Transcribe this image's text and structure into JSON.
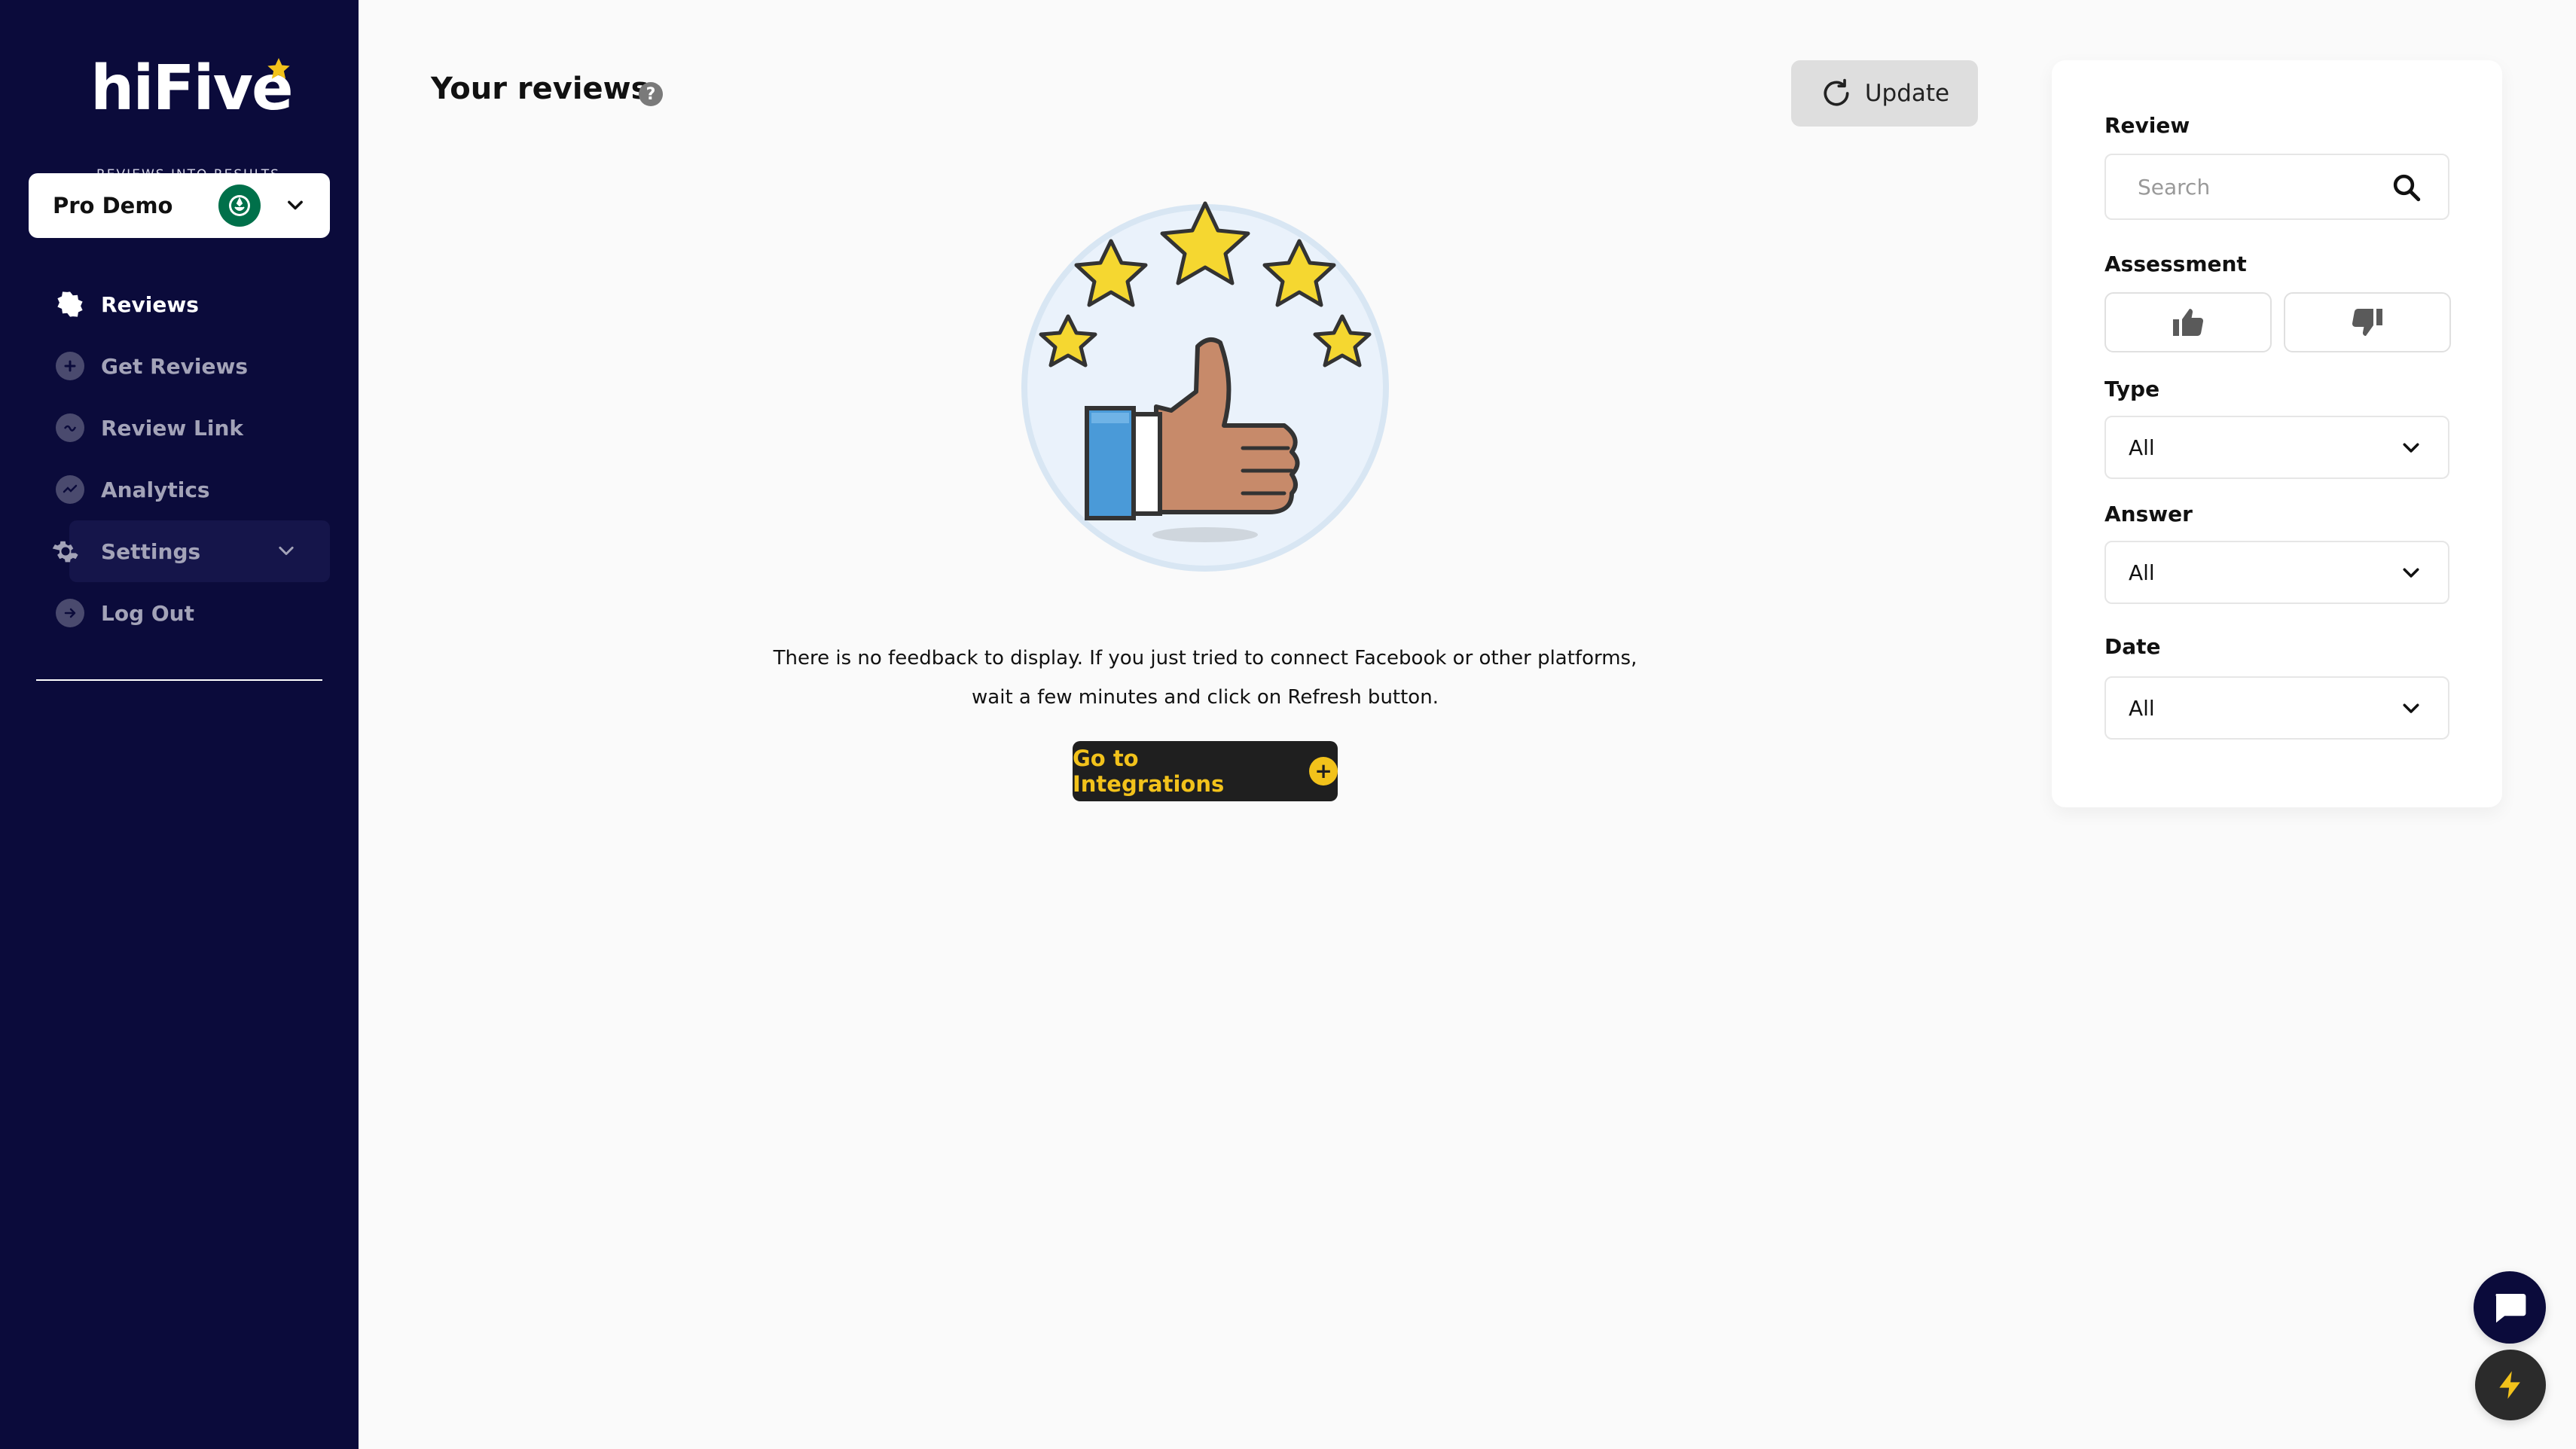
{
  "brand": {
    "name": "hiFive",
    "tagline": "REVIEWS INTO RESULTS."
  },
  "account": {
    "name": "Pro Demo",
    "avatar": "starbucks-logo"
  },
  "nav": {
    "items": [
      {
        "label": "Reviews",
        "icon": "reviews-icon",
        "active": true
      },
      {
        "label": "Get Reviews",
        "icon": "plus-icon",
        "active": false
      },
      {
        "label": "Review Link",
        "icon": "link-icon",
        "active": false
      },
      {
        "label": "Analytics",
        "icon": "analytics-icon",
        "active": false
      },
      {
        "label": "Settings",
        "icon": "gear-icon",
        "active": false
      },
      {
        "label": "Log Out",
        "icon": "logout-icon",
        "active": false
      }
    ]
  },
  "main": {
    "title": "Your reviews",
    "help": "?",
    "update_label": "Update",
    "empty_line1": "There is no feedback to display. If you just tried to connect Facebook or other platforms,",
    "empty_line2": "wait a few minutes and click on Refresh button.",
    "integrations_label": "Go to Integrations",
    "integrations_plus": "+"
  },
  "filters": {
    "review_label": "Review",
    "search_placeholder": "Search",
    "search_value": "",
    "assessment_label": "Assessment",
    "type_label": "Type",
    "type_value": "All",
    "answer_label": "Answer",
    "answer_value": "All",
    "date_label": "Date",
    "date_value": "All"
  },
  "colors": {
    "sidebar": "#0b0b3b",
    "accent": "#f2c21b",
    "button_dark": "#1f1f1f"
  }
}
